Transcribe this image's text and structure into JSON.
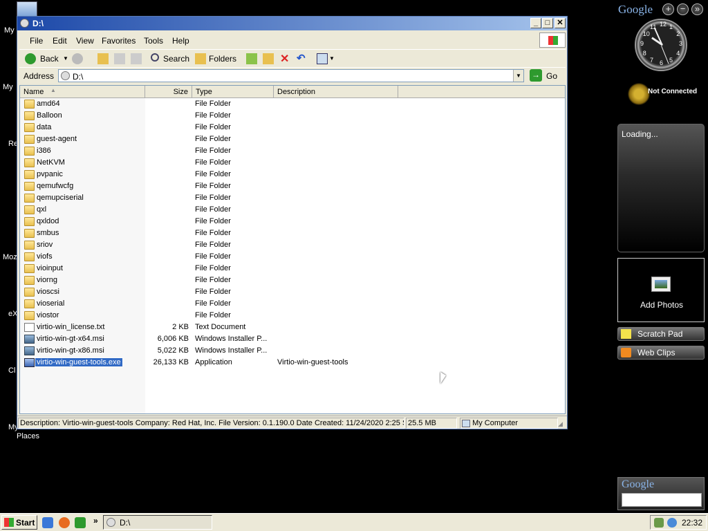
{
  "desktop": {
    "left_labels": [
      "My",
      "My",
      "Re",
      "Moz",
      "eX",
      "Cl",
      "My Network",
      "Places"
    ]
  },
  "sidebar": {
    "google": "Google",
    "add_btn": "+",
    "menu_btn": "−",
    "close_btn": "»",
    "clock_numbers": [
      "12",
      "1",
      "2",
      "3",
      "4",
      "5",
      "6",
      "7",
      "8",
      "9",
      "10",
      "11"
    ],
    "status": "Not Connected",
    "loading": "Loading...",
    "add_photos": "Add Photos",
    "scratch_pad": "Scratch Pad",
    "web_clips": "Web Clips",
    "search_logo": "Google"
  },
  "window": {
    "title": "D:\\",
    "menu": [
      "File",
      "Edit",
      "View",
      "Favorites",
      "Tools",
      "Help"
    ],
    "toolbar": {
      "back": "Back",
      "search": "Search",
      "folders": "Folders"
    },
    "address": {
      "label": "Address",
      "value": "D:\\",
      "go": "Go"
    },
    "columns": [
      "Name",
      "Size",
      "Type",
      "Description"
    ],
    "rows": [
      {
        "name": "amd64",
        "size": "",
        "type": "File Folder",
        "desc": "",
        "kind": "folder"
      },
      {
        "name": "Balloon",
        "size": "",
        "type": "File Folder",
        "desc": "",
        "kind": "folder"
      },
      {
        "name": "data",
        "size": "",
        "type": "File Folder",
        "desc": "",
        "kind": "folder"
      },
      {
        "name": "guest-agent",
        "size": "",
        "type": "File Folder",
        "desc": "",
        "kind": "folder"
      },
      {
        "name": "i386",
        "size": "",
        "type": "File Folder",
        "desc": "",
        "kind": "folder"
      },
      {
        "name": "NetKVM",
        "size": "",
        "type": "File Folder",
        "desc": "",
        "kind": "folder"
      },
      {
        "name": "pvpanic",
        "size": "",
        "type": "File Folder",
        "desc": "",
        "kind": "folder"
      },
      {
        "name": "qemufwcfg",
        "size": "",
        "type": "File Folder",
        "desc": "",
        "kind": "folder"
      },
      {
        "name": "qemupciserial",
        "size": "",
        "type": "File Folder",
        "desc": "",
        "kind": "folder"
      },
      {
        "name": "qxl",
        "size": "",
        "type": "File Folder",
        "desc": "",
        "kind": "folder"
      },
      {
        "name": "qxldod",
        "size": "",
        "type": "File Folder",
        "desc": "",
        "kind": "folder"
      },
      {
        "name": "smbus",
        "size": "",
        "type": "File Folder",
        "desc": "",
        "kind": "folder"
      },
      {
        "name": "sriov",
        "size": "",
        "type": "File Folder",
        "desc": "",
        "kind": "folder"
      },
      {
        "name": "viofs",
        "size": "",
        "type": "File Folder",
        "desc": "",
        "kind": "folder"
      },
      {
        "name": "vioinput",
        "size": "",
        "type": "File Folder",
        "desc": "",
        "kind": "folder"
      },
      {
        "name": "viorng",
        "size": "",
        "type": "File Folder",
        "desc": "",
        "kind": "folder"
      },
      {
        "name": "vioscsi",
        "size": "",
        "type": "File Folder",
        "desc": "",
        "kind": "folder"
      },
      {
        "name": "vioserial",
        "size": "",
        "type": "File Folder",
        "desc": "",
        "kind": "folder"
      },
      {
        "name": "viostor",
        "size": "",
        "type": "File Folder",
        "desc": "",
        "kind": "folder"
      },
      {
        "name": "virtio-win_license.txt",
        "size": "2 KB",
        "type": "Text Document",
        "desc": "",
        "kind": "doc"
      },
      {
        "name": "virtio-win-gt-x64.msi",
        "size": "6,006 KB",
        "type": "Windows Installer P...",
        "desc": "",
        "kind": "msi"
      },
      {
        "name": "virtio-win-gt-x86.msi",
        "size": "5,022 KB",
        "type": "Windows Installer P...",
        "desc": "",
        "kind": "msi"
      },
      {
        "name": "virtio-win-guest-tools.exe",
        "size": "26,133 KB",
        "type": "Application",
        "desc": "Virtio-win-guest-tools",
        "kind": "exe",
        "selected": true
      }
    ],
    "status": {
      "description": "Description: Virtio-win-guest-tools Company: Red Hat, Inc. File Version: 0.1.190.0 Date Created: 11/24/2020 2:25 S",
      "size": "25.5 MB",
      "zone": "My Computer"
    }
  },
  "taskbar": {
    "start": "Start",
    "chevron": "»",
    "task": "D:\\",
    "time": "22:32"
  },
  "colors": {
    "selection": "#316ac5",
    "titlebar": "#1c48a8",
    "taskbar": "#ece9d8"
  }
}
